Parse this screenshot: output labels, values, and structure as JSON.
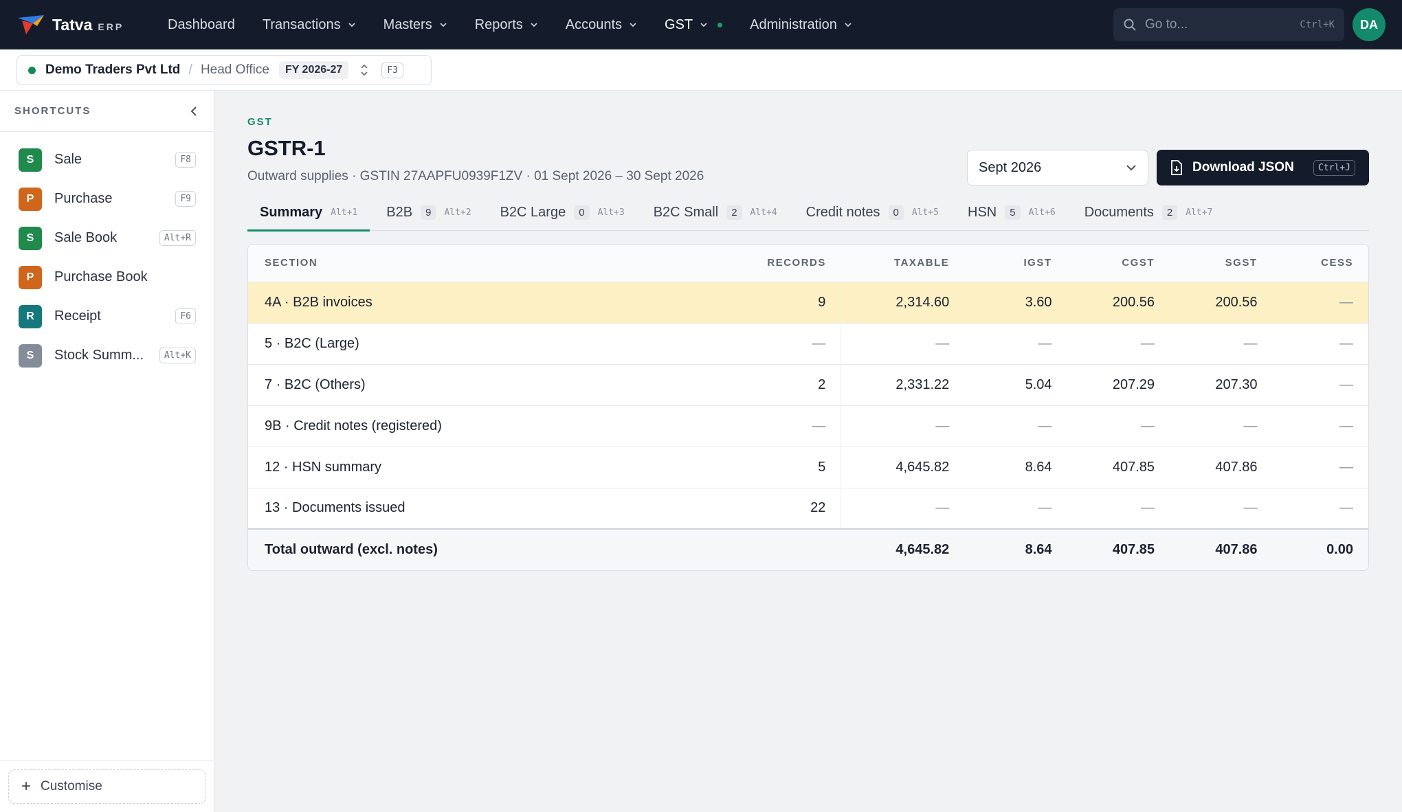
{
  "brand": {
    "name": "Tatva",
    "suffix": "ERP"
  },
  "nav": [
    {
      "label": "Dashboard",
      "dropdown": false
    },
    {
      "label": "Transactions",
      "dropdown": true
    },
    {
      "label": "Masters",
      "dropdown": true
    },
    {
      "label": "Reports",
      "dropdown": true
    },
    {
      "label": "Accounts",
      "dropdown": true
    },
    {
      "label": "GST",
      "dropdown": true,
      "active": true,
      "status_dot": true
    },
    {
      "label": "Administration",
      "dropdown": true
    }
  ],
  "search": {
    "placeholder": "Go to...",
    "shortcut": "Ctrl+K"
  },
  "user": {
    "initials": "DA"
  },
  "context": {
    "company": "Demo Traders Pvt Ltd",
    "branch": "Head Office",
    "fy": "FY 2026-27",
    "shortcut": "F3",
    "status_color": "#168a52"
  },
  "sidebar": {
    "title": "SHORTCUTS",
    "items": [
      {
        "badge": "S",
        "label": "Sale",
        "shortcut": "F8",
        "color": "#1f8a4c"
      },
      {
        "badge": "P",
        "label": "Purchase",
        "shortcut": "F9",
        "color": "#d0661c"
      },
      {
        "badge": "S",
        "label": "Sale Book",
        "shortcut": "Alt+R",
        "color": "#1f8a4c"
      },
      {
        "badge": "P",
        "label": "Purchase Book",
        "shortcut": "",
        "color": "#d0661c"
      },
      {
        "badge": "R",
        "label": "Receipt",
        "shortcut": "F6",
        "color": "#15787c"
      },
      {
        "badge": "S",
        "label": "Stock Summ...",
        "shortcut": "Alt+K",
        "color": "#848b99"
      }
    ],
    "customise": "Customise"
  },
  "page": {
    "eyebrow": "GST",
    "title": "GSTR-1",
    "subtitle": "Outward supplies · GSTIN 27AAPFU0939F1ZV · 01 Sept 2026 – 30 Sept 2026",
    "period": "Sept 2026",
    "download": {
      "label": "Download JSON",
      "shortcut": "Ctrl+J"
    }
  },
  "tabs": [
    {
      "label": "Summary",
      "count": "",
      "hotkey": "Alt+1",
      "active": true
    },
    {
      "label": "B2B",
      "count": "9",
      "hotkey": "Alt+2"
    },
    {
      "label": "B2C Large",
      "count": "0",
      "hotkey": "Alt+3"
    },
    {
      "label": "B2C Small",
      "count": "2",
      "hotkey": "Alt+4"
    },
    {
      "label": "Credit notes",
      "count": "0",
      "hotkey": "Alt+5"
    },
    {
      "label": "HSN",
      "count": "5",
      "hotkey": "Alt+6"
    },
    {
      "label": "Documents",
      "count": "2",
      "hotkey": "Alt+7"
    }
  ],
  "table": {
    "columns": [
      "SECTION",
      "RECORDS",
      "TAXABLE",
      "IGST",
      "CGST",
      "SGST",
      "CESS"
    ],
    "rows": [
      [
        "4A · B2B invoices",
        "9",
        "2,314.60",
        "3.60",
        "200.56",
        "200.56",
        "—"
      ],
      [
        "5 · B2C (Large)",
        "—",
        "—",
        "—",
        "—",
        "—",
        "—"
      ],
      [
        "7 · B2C (Others)",
        "2",
        "2,331.22",
        "5.04",
        "207.29",
        "207.30",
        "—"
      ],
      [
        "9B · Credit notes (registered)",
        "—",
        "—",
        "—",
        "—",
        "—",
        "—"
      ],
      [
        "12 · HSN summary",
        "5",
        "4,645.82",
        "8.64",
        "407.85",
        "407.86",
        "—"
      ],
      [
        "13 · Documents issued",
        "22",
        "—",
        "—",
        "—",
        "—",
        "—"
      ]
    ],
    "highlighted_row": 0,
    "total": [
      "Total outward (excl. notes)",
      "",
      "4,645.82",
      "8.64",
      "407.85",
      "407.86",
      "0.00"
    ]
  }
}
